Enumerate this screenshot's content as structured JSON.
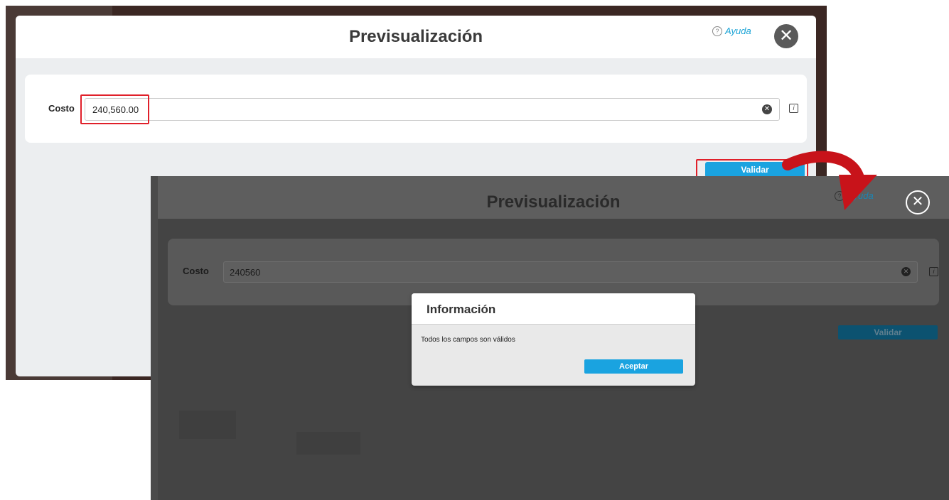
{
  "before": {
    "title": "Previsualización",
    "help_label": "Ayuda",
    "field_label": "Costo",
    "field_value": "240,560.00",
    "validate_label": "Validar"
  },
  "after": {
    "title": "Previsualización",
    "help_label": "Ayuda",
    "field_label": "Costo",
    "field_value": "240560",
    "validate_label": "Validar"
  },
  "dialog": {
    "title": "Información",
    "message": "Todos los campos son válidos",
    "accept_label": "Aceptar"
  },
  "colors": {
    "accent": "#1aa3e0",
    "highlight": "#e0202a",
    "arrow": "#c8131a"
  }
}
